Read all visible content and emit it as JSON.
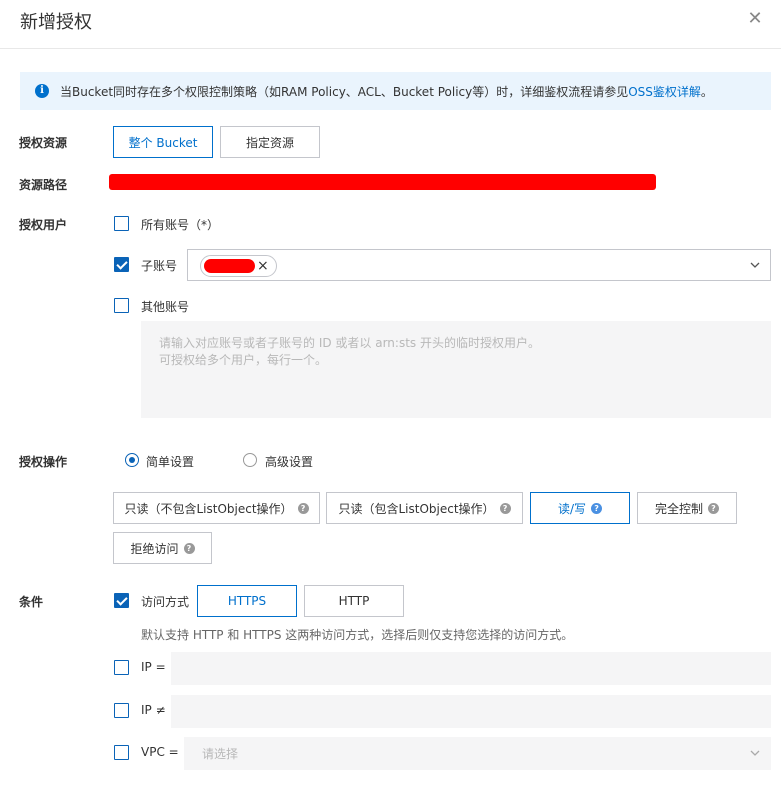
{
  "dialog": {
    "title": "新增授权",
    "close_icon": "close-icon"
  },
  "notice": {
    "icon": "info-icon",
    "text": "当Bucket同时存在多个权限控制策略（如RAM Policy、ACL、Bucket Policy等）时，详细鉴权流程请参见",
    "link": "OSS鉴权详解",
    "suffix": "。"
  },
  "resource": {
    "label": "授权资源",
    "options": [
      "整个 Bucket",
      "指定资源"
    ],
    "selected": "整个 Bucket"
  },
  "path": {
    "label": "资源路径"
  },
  "users": {
    "label": "授权用户",
    "all_accounts": {
      "label": "所有账号（*）",
      "checked": false
    },
    "sub_account": {
      "label": "子账号",
      "checked": true,
      "tag_remove": "×"
    },
    "other_accounts": {
      "label": "其他账号",
      "checked": false,
      "placeholder_line1": "请输入对应账号或者子账号的 ID 或者以 arn:sts 开头的临时授权用户。",
      "placeholder_line2": "可授权给多个用户，每行一个。"
    }
  },
  "operations": {
    "label": "授权操作",
    "modes": [
      "简单设置",
      "高级设置"
    ],
    "selected_mode": "简单设置",
    "actions": [
      "只读（不包含ListObject操作）",
      "只读（包含ListObject操作）",
      "读/写",
      "完全控制",
      "拒绝访问"
    ],
    "selected_action": "读/写",
    "help_icon": "?"
  },
  "conditions": {
    "label": "条件",
    "access": {
      "label": "访问方式",
      "checked": true,
      "options": [
        "HTTPS",
        "HTTP"
      ],
      "selected": "HTTPS"
    },
    "hint": "默认支持 HTTP 和 HTTPS 这两种访问方式，选择后则仅支持您选择的访问方式。",
    "ip_eq": {
      "label": "IP =",
      "checked": false
    },
    "ip_neq": {
      "label": "IP ≠",
      "checked": false
    },
    "vpc": {
      "label": "VPC =",
      "checked": false,
      "placeholder": "请选择"
    }
  },
  "colors": {
    "accent": "#0070cc",
    "notice_bg": "#eaf4fd",
    "redacted": "#ff0000"
  }
}
